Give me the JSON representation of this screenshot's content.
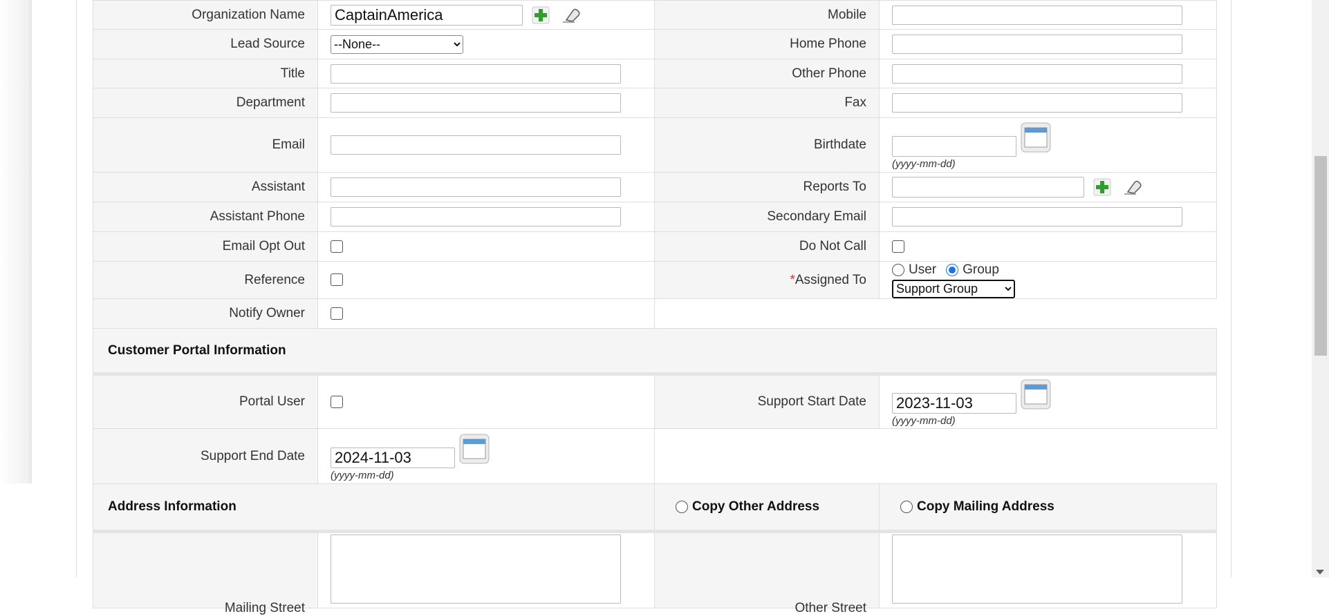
{
  "form": {
    "organization_name": {
      "label": "Organization Name",
      "value": "CaptainAmerica"
    },
    "mobile": {
      "label": "Mobile",
      "value": ""
    },
    "lead_source": {
      "label": "Lead Source",
      "selected": "--None--"
    },
    "home_phone": {
      "label": "Home Phone",
      "value": ""
    },
    "title": {
      "label": "Title",
      "value": ""
    },
    "other_phone": {
      "label": "Other Phone",
      "value": ""
    },
    "department": {
      "label": "Department",
      "value": ""
    },
    "fax": {
      "label": "Fax",
      "value": ""
    },
    "email": {
      "label": "Email",
      "value": ""
    },
    "birthdate": {
      "label": "Birthdate",
      "value": "",
      "format": "(yyyy-mm-dd)"
    },
    "assistant": {
      "label": "Assistant",
      "value": ""
    },
    "reports_to": {
      "label": "Reports To",
      "value": ""
    },
    "assistant_phone": {
      "label": "Assistant Phone",
      "value": ""
    },
    "secondary_email": {
      "label": "Secondary Email",
      "value": ""
    },
    "email_opt_out": {
      "label": "Email Opt Out",
      "checked": false
    },
    "do_not_call": {
      "label": "Do Not Call",
      "checked": false
    },
    "reference": {
      "label": "Reference",
      "checked": false
    },
    "assigned_to": {
      "required_mark": "*",
      "label": "Assigned To",
      "user_label": "User",
      "group_label": "Group",
      "selected_type": "Group",
      "selected": "Support Group"
    },
    "notify_owner": {
      "label": "Notify Owner",
      "checked": false
    }
  },
  "customer_portal": {
    "title": "Customer Portal Information",
    "portal_user": {
      "label": "Portal User",
      "checked": false
    },
    "support_start_date": {
      "label": "Support Start Date",
      "value": "2023-11-03",
      "format": "(yyyy-mm-dd)"
    },
    "support_end_date": {
      "label": "Support End Date",
      "value": "2024-11-03",
      "format": "(yyyy-mm-dd)"
    }
  },
  "address": {
    "title": "Address Information",
    "copy_other_label": "Copy Other Address",
    "copy_mailing_label": "Copy Mailing Address",
    "mailing_street": {
      "label": "Mailing Street",
      "value": ""
    },
    "other_street": {
      "label": "Other Street",
      "value": ""
    }
  },
  "icons": {
    "add": "plus-icon",
    "clear": "eraser-icon",
    "calendar": "calendar-icon"
  },
  "colors": {
    "label_bg": "#f5f5f5",
    "border": "#dedede",
    "required": "#e03030",
    "add_icon": "#2e9e2e",
    "radio_selected": "#1a73e8"
  }
}
